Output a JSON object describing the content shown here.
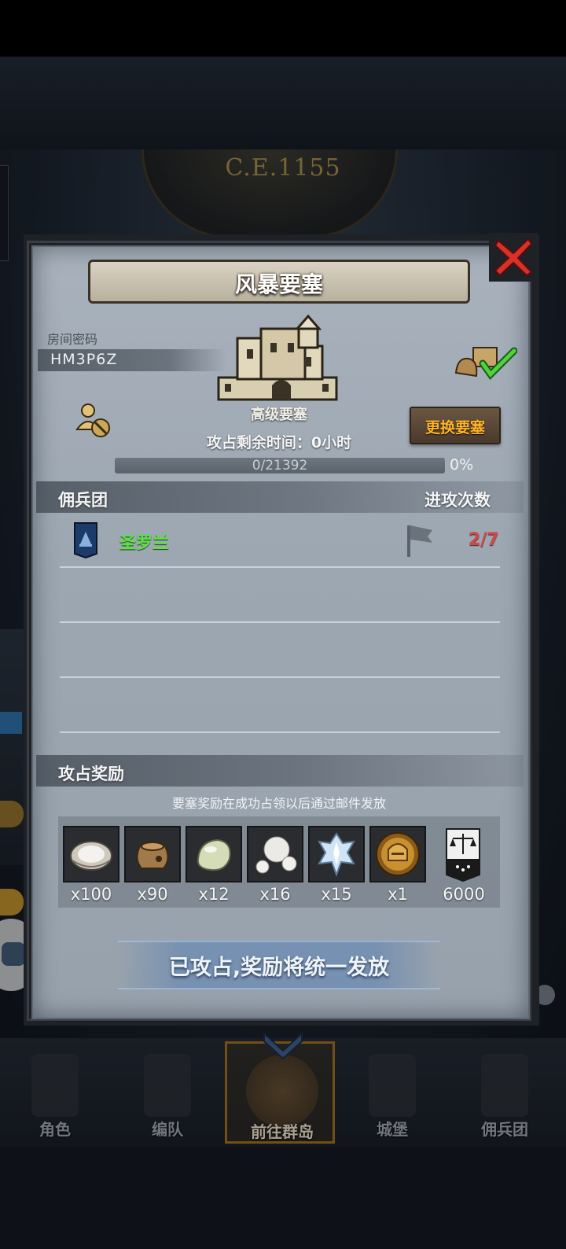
{
  "background": {
    "year": "C.E.1155"
  },
  "dialog": {
    "title": "风暴要塞",
    "room_label": "房间密码",
    "room_code": "HM3P6Z",
    "fort_level": "高级要塞",
    "remaining_time": "攻占剩余时间：0小时",
    "change_button": "更换要塞",
    "progress": {
      "text": "0/21392",
      "current": 0,
      "total": 21392,
      "percent_label": "0%",
      "fill_fraction": 0
    },
    "guild_section": {
      "left_header": "佣兵团",
      "right_header": "进攻次数",
      "rows": [
        {
          "name": "圣罗兰",
          "attacks": "2/7",
          "name_color": "#5fe04a",
          "count_color": "#d24848"
        }
      ]
    },
    "reward_section": {
      "header": "攻占奖励",
      "note": "要塞奖励在成功占领以后通过邮件发放",
      "items": [
        {
          "icon": "oyster-shell-icon",
          "qty": "x100"
        },
        {
          "icon": "sack-icon",
          "qty": "x90"
        },
        {
          "icon": "jade-stone-icon",
          "qty": "x12"
        },
        {
          "icon": "pearls-icon",
          "qty": "x16"
        },
        {
          "icon": "crystal-icon",
          "qty": "x15"
        },
        {
          "icon": "knight-medal-icon",
          "qty": "x1"
        },
        {
          "icon": "justice-banner-icon",
          "qty": "6000"
        }
      ]
    },
    "claim_text": "已攻占,奖励将统一发放"
  },
  "nav": {
    "items": [
      {
        "label": "角色"
      },
      {
        "label": "编队"
      },
      {
        "label": "前往群岛"
      },
      {
        "label": "城堡"
      },
      {
        "label": "佣兵团"
      }
    ]
  },
  "colors": {
    "accent_gold": "#ffb428",
    "guild_green": "#5fe04a",
    "attack_red": "#d24848"
  }
}
